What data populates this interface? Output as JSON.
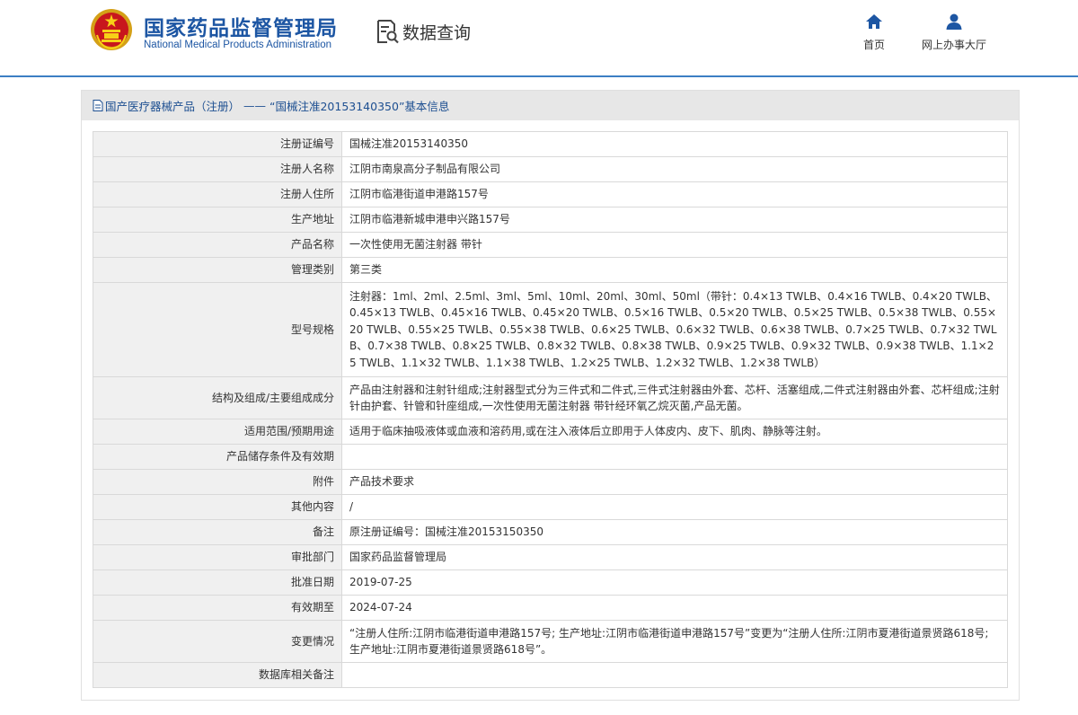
{
  "header": {
    "logo_cn": "国家药品监督管理局",
    "logo_en": "National Medical Products Administration",
    "data_query": "数据查询",
    "nav": [
      {
        "label": "首页",
        "icon": "home-icon"
      },
      {
        "label": "网上办事大厅",
        "icon": "user-icon"
      }
    ]
  },
  "breadcrumb": {
    "text": "国产医疗器械产品（注册）",
    "separator": "——",
    "detail": "“国械注准20153140350”基本信息"
  },
  "colors": {
    "brand": "#1d56a3",
    "header_line": "#3c7fc4",
    "label_bg": "#f0f0f0",
    "panel_head_bg": "#e7e7e7"
  },
  "rows": [
    {
      "label": "注册证编号",
      "value": "国械注准20153140350"
    },
    {
      "label": "注册人名称",
      "value": "江阴市南泉高分子制品有限公司"
    },
    {
      "label": "注册人住所",
      "value": "江阴市临港街道申港路157号"
    },
    {
      "label": "生产地址",
      "value": "江阴市临港新城申港申兴路157号"
    },
    {
      "label": "产品名称",
      "value": "一次性使用无菌注射器 带针"
    },
    {
      "label": "管理类别",
      "value": "第三类"
    },
    {
      "label": "型号规格",
      "value": "注射器：1ml、2ml、2.5ml、3ml、5ml、10ml、20ml、30ml、50ml（带针：0.4×13 TWLB、0.4×16 TWLB、0.4×20 TWLB、0.45×13 TWLB、0.45×16 TWLB、0.45×20 TWLB、0.5×16 TWLB、0.5×20 TWLB、0.5×25 TWLB、0.5×38 TWLB、0.55×20 TWLB、0.55×25 TWLB、0.55×38 TWLB、0.6×25 TWLB、0.6×32 TWLB、0.6×38 TWLB、0.7×25 TWLB、0.7×32 TWLB、0.7×38 TWLB、0.8×25 TWLB、0.8×32 TWLB、0.8×38 TWLB、0.9×25 TWLB、0.9×32 TWLB、0.9×38 TWLB、1.1×25 TWLB、1.1×32 TWLB、1.1×38 TWLB、1.2×25 TWLB、1.2×32 TWLB、1.2×38 TWLB）"
    },
    {
      "label": "结构及组成/主要组成成分",
      "value": "产品由注射器和注射针组成;注射器型式分为三件式和二件式,三件式注射器由外套、芯杆、活塞组成,二件式注射器由外套、芯杆组成;注射针由护套、针管和针座组成,一次性使用无菌注射器 带针经环氧乙烷灭菌,产品无菌。"
    },
    {
      "label": "适用范围/预期用途",
      "value": "适用于临床抽吸液体或血液和溶药用,或在注入液体后立即用于人体皮内、皮下、肌肉、静脉等注射。"
    },
    {
      "label": "产品储存条件及有效期",
      "value": ""
    },
    {
      "label": "附件",
      "value": "产品技术要求"
    },
    {
      "label": "其他内容",
      "value": "/"
    },
    {
      "label": "备注",
      "value": "原注册证编号：国械注准20153150350"
    },
    {
      "label": "审批部门",
      "value": "国家药品监督管理局"
    },
    {
      "label": "批准日期",
      "value": "2019-07-25"
    },
    {
      "label": "有效期至",
      "value": "2024-07-24"
    },
    {
      "label": "变更情况",
      "value": "“注册人住所:江阴市临港街道申港路157号; 生产地址:江阴市临港街道申港路157号”变更为“注册人住所:江阴市夏港街道景贤路618号; 生产地址:江阴市夏港街道景贤路618号”。"
    },
    {
      "label": "数据库相关备注",
      "value": ""
    }
  ]
}
